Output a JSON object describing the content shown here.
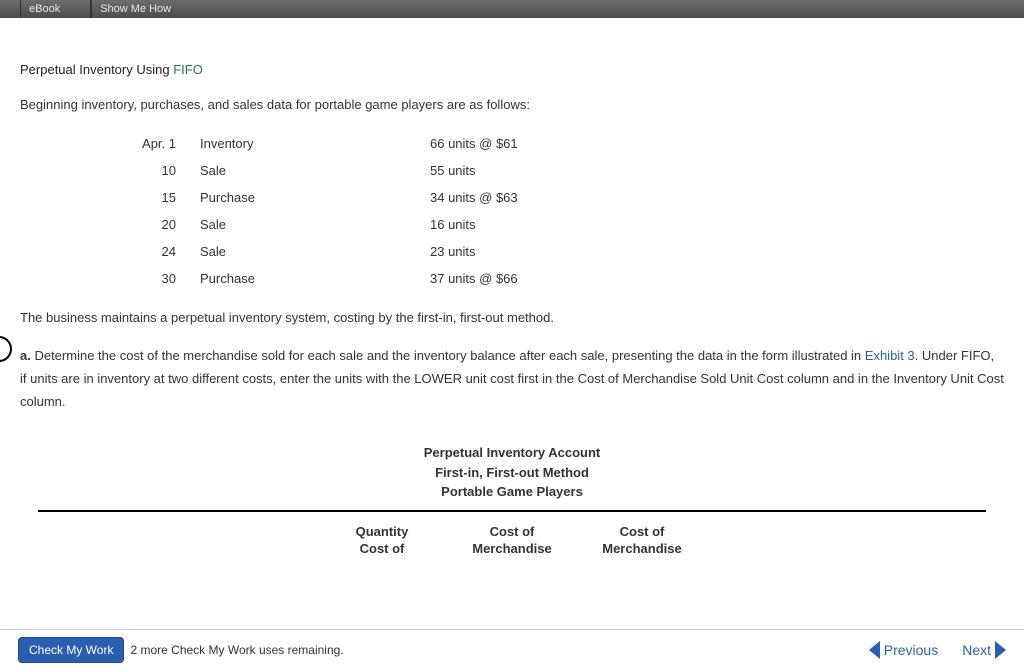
{
  "toolbar": {
    "item1": "eBook",
    "item2": "Show Me How"
  },
  "title": {
    "a": "Perpetual Inventory Using ",
    "b": "FIFO"
  },
  "intro": "Beginning inventory, purchases, and sales data for portable game players are as follows:",
  "rows": [
    {
      "date": "Apr. 1",
      "type": "Inventory",
      "amt": "66 units @ $61"
    },
    {
      "date": "10",
      "type": "Sale",
      "amt": "55 units"
    },
    {
      "date": "15",
      "type": "Purchase",
      "amt": "34 units @ $63"
    },
    {
      "date": "20",
      "type": "Sale",
      "amt": "16 units"
    },
    {
      "date": "24",
      "type": "Sale",
      "amt": "23 units"
    },
    {
      "date": "30",
      "type": "Purchase",
      "amt": "37 units @ $66"
    }
  ],
  "summary": "The business maintains a perpetual inventory system, costing by the first-in, first-out method.",
  "question": {
    "label": "a.",
    "part1": "  Determine the cost of the merchandise sold for each sale and the inventory balance after each sale, presenting the data in the form illustrated in ",
    "exhibit": "Exhibit 3",
    "part2": ". Under FIFO, if units are in inventory at two different costs, enter the units with the LOWER unit cost first in the Cost of Merchandise Sold Unit Cost column and in the Inventory Unit Cost column."
  },
  "table_title": {
    "l1": "Perpetual Inventory Account",
    "l2": "First-in, First-out Method",
    "l3": "Portable Game Players"
  },
  "colheads": {
    "c1a": "Quantity",
    "c1b": "Cost of",
    "c2a": "Cost of",
    "c2b": "Merchandise",
    "c3a": "Cost of",
    "c3b": "Merchandise"
  },
  "footer": {
    "check": "Check My Work",
    "uses": "2 more Check My Work uses remaining.",
    "prev": "Previous",
    "next": "Next"
  }
}
